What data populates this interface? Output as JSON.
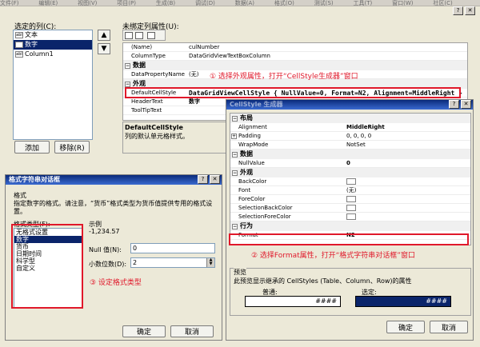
{
  "menubar": [
    "文件(F)",
    "编辑(E)",
    "视图(V)",
    "项目(P)",
    "生成(B)",
    "调试(D)",
    "数据(A)",
    "格式(O)",
    "测试(S)",
    "工具(T)",
    "窗口(W)",
    "社区(C)"
  ],
  "column_editor": {
    "selected_columns_label": "选定的列(C):",
    "columns": [
      {
        "icon": "abl",
        "name": "文本"
      },
      {
        "icon": "abl",
        "name": "数字"
      },
      {
        "icon": "abl",
        "name": "Column1"
      }
    ],
    "unbound_props_label": "未绑定列属性(U):",
    "add_label": "添加",
    "remove_label": "移除(R)",
    "up_arrow": "▲",
    "down_arrow": "▼",
    "close_glyph": "✕",
    "help_glyph": "?",
    "props": {
      "rows_top": [
        {
          "name": "(Name)",
          "value": "culNumber"
        },
        {
          "name": "ColumnType",
          "value": "DataGridViewTextBoxColumn"
        }
      ],
      "cat_data": "数据",
      "data_rows": [
        {
          "name": "DataPropertyName",
          "value": "(无)"
        }
      ],
      "cat_appearance": "外观",
      "appearance_rows": [
        {
          "name": "DefaultCellStyle",
          "value": "DataGridViewCellStyle { NullValue=0, Format=N2, Alignment=MiddleRight }"
        },
        {
          "name": "HeaderText",
          "value": "数字"
        },
        {
          "name": "ToolTipText",
          "value": ""
        }
      ],
      "desc_title": "DefaultCellStyle",
      "desc_text": "列的默认单元格样式。"
    }
  },
  "annotations": {
    "step1": "① 选择外观属性，打开“CellStyle生成器”窗口",
    "step2": "② 选择Format属性，打开“格式字符串对话框”窗口",
    "step3": "③ 设定格式类型"
  },
  "cellstyle_builder": {
    "title": "CellStyle 生成器",
    "cat_layout": "布局",
    "layout_rows": [
      {
        "name": "Alignment",
        "value": "MiddleRight"
      },
      {
        "name": "Padding",
        "value": "0, 0, 0, 0"
      },
      {
        "name": "WrapMode",
        "value": "NotSet"
      }
    ],
    "cat_data": "数据",
    "data_rows": [
      {
        "name": "NullValue",
        "value": "0"
      }
    ],
    "cat_appearance": "外观",
    "appearance_rows": [
      {
        "name": "BackColor",
        "value": ""
      },
      {
        "name": "Font",
        "value": "(无)"
      },
      {
        "name": "ForeColor",
        "value": ""
      },
      {
        "name": "SelectionBackColor",
        "value": ""
      },
      {
        "name": "SelectionForeColor",
        "value": ""
      }
    ],
    "cat_behavior": "行为",
    "behavior_rows": [
      {
        "name": "Format",
        "value": "N2"
      }
    ],
    "preview_label": "预览",
    "preview_desc": "此预览显示继承的 CellStyles (Table、Column、Row)的属性",
    "normal_label": "普通:",
    "selected_label": "选定:",
    "preview_value": "####",
    "ok_label": "确定",
    "cancel_label": "取消"
  },
  "format_dialog": {
    "title": "格式字符串对话框",
    "format_group": "格式",
    "format_desc": "指定数字的格式。请注意，“货币”格式类型为货币值提供专用的格式设置。",
    "format_type_label": "格式类型(F):",
    "format_types": [
      "无格式设置",
      "数字",
      "货币",
      "日期时间",
      "科学型",
      "自定义"
    ],
    "selected_type": "数字",
    "sample_label": "示例",
    "sample_value": "-1,234.57",
    "null_label": "Null 值(N):",
    "null_value": "0",
    "decimals_label": "小数位数(D):",
    "decimals_value": "2",
    "ok_label": "确定",
    "cancel_label": "取消"
  }
}
